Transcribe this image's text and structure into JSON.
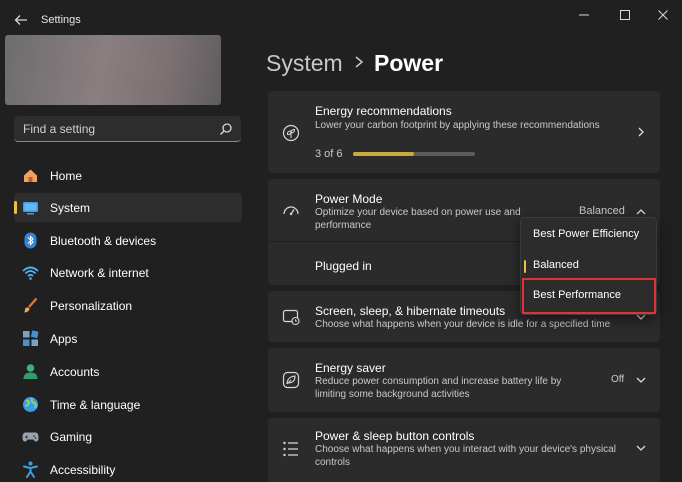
{
  "app": {
    "title": "Settings"
  },
  "search": {
    "placeholder": "Find a setting"
  },
  "sidebar": {
    "items": [
      {
        "label": "Home",
        "icon": "home-icon"
      },
      {
        "label": "System",
        "icon": "system-icon",
        "active": true
      },
      {
        "label": "Bluetooth & devices",
        "icon": "bluetooth-icon"
      },
      {
        "label": "Network & internet",
        "icon": "wifi-icon"
      },
      {
        "label": "Personalization",
        "icon": "brush-icon"
      },
      {
        "label": "Apps",
        "icon": "apps-icon"
      },
      {
        "label": "Accounts",
        "icon": "person-icon"
      },
      {
        "label": "Time & language",
        "icon": "globe-icon"
      },
      {
        "label": "Gaming",
        "icon": "gamepad-icon"
      },
      {
        "label": "Accessibility",
        "icon": "accessibility-icon"
      }
    ]
  },
  "breadcrumb": {
    "parent": "System",
    "current": "Power"
  },
  "energy_recommendations": {
    "title": "Energy recommendations",
    "description": "Lower your carbon footprint by applying these recommendations",
    "progress_text": "3 of 6",
    "progress_fraction": 0.5
  },
  "power_mode": {
    "title": "Power Mode",
    "description_line1": "Optimize your device based on power use and",
    "description_line2": "performance",
    "value": "Balanced",
    "plugged_in_label": "Plugged in",
    "options": [
      "Best Power Efficiency",
      "Balanced",
      "Best Performance"
    ],
    "selected": "Balanced"
  },
  "screen_sleep": {
    "title": "Screen, sleep, & hibernate timeouts",
    "description": "Choose what happens when your device is idle for a specified time"
  },
  "energy_saver": {
    "title": "Energy saver",
    "description_line1": "Reduce power consumption and increase battery life by",
    "description_line2": "limiting some background activities",
    "value": "Off"
  },
  "power_sleep_buttons": {
    "title": "Power & sleep button controls",
    "description_line1": "Choose what happens when you interact with your device's physical",
    "description_line2": "controls"
  },
  "colors": {
    "accent": "#e8c04a",
    "highlight": "#e0303a",
    "progress": "#c9a93a"
  }
}
